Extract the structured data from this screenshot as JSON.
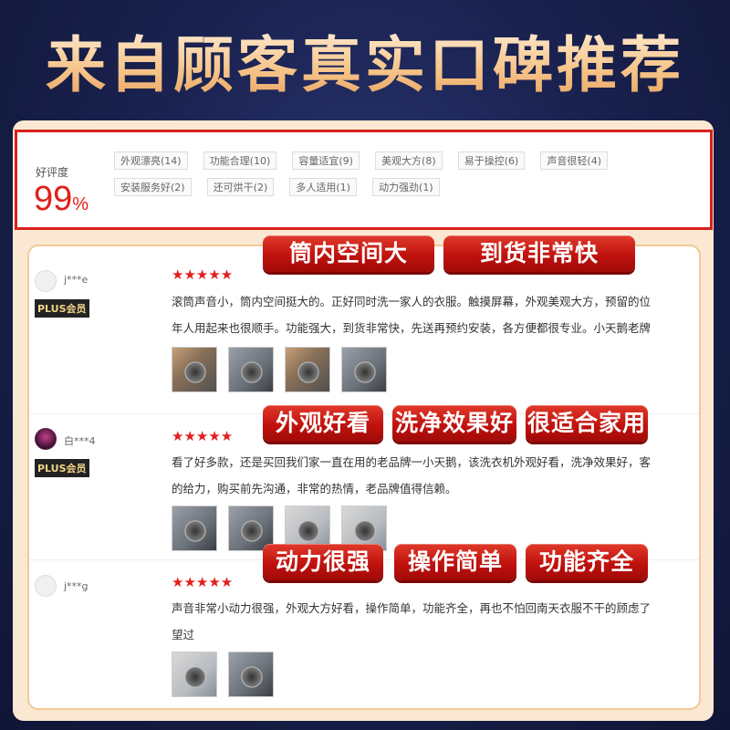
{
  "page": {
    "headline": "来自顾客真实口碑推荐"
  },
  "rating": {
    "label": "好评度",
    "value": "99",
    "unit": "%",
    "tags": [
      "外观漂亮(14)",
      "功能合理(10)",
      "容量适宜(9)",
      "美观大方(8)",
      "易于操控(6)",
      "声音很轻(4)",
      "安装服务好(2)",
      "还可烘干(2)",
      "多人适用(1)",
      "动力强劲(1)"
    ]
  },
  "badges": {
    "row1": [
      "筒内空间大",
      "到货非常快"
    ],
    "row2": [
      "外观好看",
      "洗净效果好",
      "很适合家用"
    ],
    "row3": [
      "动力很强",
      "操作简单",
      "功能齐全"
    ]
  },
  "reviews": [
    {
      "user": "j***e",
      "member": "PLUS会员",
      "stars": "★★★★★",
      "lines": [
        "滚筒声音小，筒内空间挺大的。正好同时洗一家人的衣服。触摸屏幕，外观美观大方，预留的位",
        "年人用起来也很顺手。功能强大，到货非常快，先送再预约安装，各方便都很专业。小天鹅老牌"
      ],
      "photos": 4
    },
    {
      "user": "白***4",
      "member": "PLUS会员",
      "stars": "★★★★★",
      "lines": [
        "看了好多款，还是买回我们家一直在用的老品牌一小天鹅，该洗衣机外观好看，洗净效果好，客",
        "的给力，购买前先沟通，非常的热情，老品牌值得信赖。"
      ],
      "photos": 4
    },
    {
      "user": "j***g",
      "member": "",
      "stars": "★★★★★",
      "lines": [
        "声音非常小动力很强，外观大方好看，操作简单，功能齐全，再也不怕回南天衣服不干的顾虑了",
        "望过"
      ],
      "photos": 2
    }
  ],
  "colors": {
    "accent": "#e0201a",
    "badge": "#c0120e",
    "frame": "#fbe8d2"
  }
}
